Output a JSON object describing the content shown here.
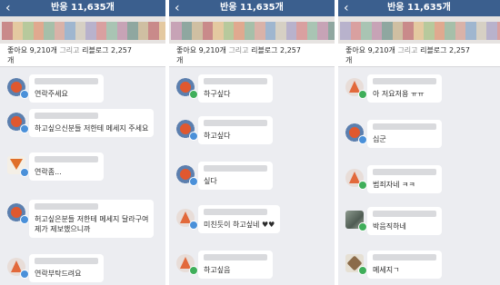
{
  "colors": {
    "header_bg": "#3b5f8e",
    "chat_bg": "#ecedf1",
    "bubble_bg": "#ffffff",
    "badge_blue": "#4a90d9",
    "badge_green": "#3fae5a"
  },
  "panels": [
    {
      "header": {
        "back_icon": "‹",
        "title": "반응 11,635개"
      },
      "likes": {
        "line1": "좋아요 9,210개",
        "and": "그리고",
        "line1b": "리블로그 2,257",
        "line2": "개"
      },
      "comments": [
        {
          "avatar": "red-circle",
          "badge": "blue",
          "text": "연락주세요"
        },
        {
          "avatar": "red-circle",
          "badge": "blue",
          "text": "하고싶으신분들 저한테 메세지 주세요"
        },
        {
          "avatar": "fox",
          "badge": "blue",
          "text": "연락좀..."
        },
        {
          "avatar": "red-circle",
          "badge": "blue",
          "text": "허고싶은분들 저한테 메세지 달라구여\n제가 제보했으니까"
        },
        {
          "avatar": "triangle",
          "badge": "blue",
          "text": "연락부탁드려요"
        }
      ]
    },
    {
      "header": {
        "back_icon": "‹",
        "title": "반응 11,635개"
      },
      "likes": {
        "line1": "좋아요 9,210개",
        "and": "그리고",
        "line1b": "리블로그 2,257",
        "line2": "개"
      },
      "comments": [
        {
          "avatar": "red-circle",
          "badge": "green",
          "text": "하구싶다"
        },
        {
          "avatar": "red-circle",
          "badge": "blue",
          "text": "하고싶다"
        },
        {
          "avatar": "red-circle",
          "badge": "blue",
          "text": "싶다"
        },
        {
          "avatar": "triangle",
          "badge": "blue",
          "text": "미친듯이 하고싶네 ♥♥"
        },
        {
          "avatar": "triangle",
          "badge": "green",
          "text": "하고싶음"
        }
      ]
    },
    {
      "header": {
        "back_icon": "‹",
        "title": "반응 11,635개"
      },
      "likes": {
        "line1": "좋아요 9,210개",
        "and": "그리고",
        "line1b": "리블로그 2,257",
        "line2": "개"
      },
      "comments": [
        {
          "avatar": "triangle",
          "badge": "green",
          "text": "아 저요저용 ㅠㅠ"
        },
        {
          "avatar": "red-circle",
          "badge": "blue",
          "text": "십군"
        },
        {
          "avatar": "triangle",
          "badge": "green",
          "text": "범죄자네 ㅋㅋ"
        },
        {
          "avatar": "photo",
          "badge": "green",
          "text": "박음직하네"
        },
        {
          "avatar": "box",
          "badge": "green",
          "text": "메세지ㄱ"
        }
      ]
    }
  ]
}
